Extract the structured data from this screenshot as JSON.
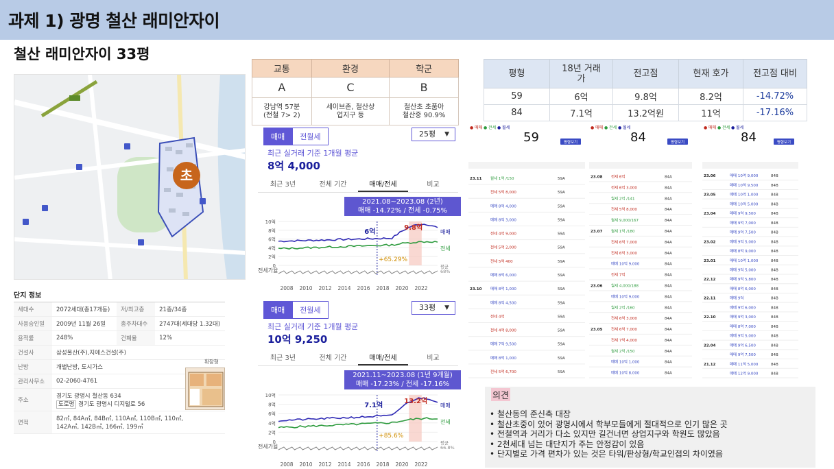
{
  "header": {
    "title": "과제 1) 광명 철산 래미안자이"
  },
  "subtitle": "철산 래미안자이 33평",
  "map": {
    "school_badge": "초"
  },
  "complex_info": {
    "title": "단지 정보",
    "rows": [
      {
        "k1": "세대수",
        "v1": "2072세대(총17개동)",
        "k2": "저/최고층",
        "v2": "21층/34층"
      },
      {
        "k1": "사용승인일",
        "v1": "2009년 11월 26일",
        "k2": "총주차대수",
        "v2": "2747대(세대당 1.32대)"
      },
      {
        "k1": "용적률",
        "v1": "248%",
        "k2": "건폐율",
        "v2": "12%"
      },
      {
        "k1": "건설사",
        "v1": "삼성물산(주),지에스건설(주)"
      },
      {
        "k1": "난방",
        "v1": "개별난방, 도시가스"
      },
      {
        "k1": "관리사무소",
        "v1": "02-2060-4761"
      },
      {
        "k1": "주소",
        "v1": "경기도 광명시 철산동 634",
        "v1b": "도로명",
        "v1c": "경기도 광명시 디지털로 56"
      },
      {
        "k1": "면적",
        "v1": "82㎡, 84A㎡, 84B㎡, 110A㎡, 110B㎡, 110㎡, 142A㎡, 142B㎡, 166㎡, 199㎡"
      }
    ],
    "floorplan_label": "확장형"
  },
  "rating": {
    "headers": [
      "교통",
      "환경",
      "학군"
    ],
    "grades": [
      "A",
      "C",
      "B"
    ],
    "notes": [
      "강남역 57분\n(전철 7> 2)",
      "세이브존, 철산상\n업지구 등",
      "철산초 초품아\n철산중 90.9%"
    ]
  },
  "price_table": {
    "headers": [
      "평형",
      "18년 거래\n가",
      "전고점",
      "현재 호가",
      "전고점 대비"
    ],
    "rows": [
      [
        "59",
        "6억",
        "9.8억",
        "8.2억",
        "-14.72%"
      ],
      [
        "84",
        "7.1억",
        "13.2억원",
        "11억",
        "-17.16%"
      ]
    ]
  },
  "panel1": {
    "seg_on": "매매",
    "seg_off": "전월세",
    "select": "25평",
    "note": "최근 실거래 기준 1개월 평균",
    "price": "8억 4,000",
    "tabs": [
      "최근 3년",
      "전체 기간",
      "매매/전세",
      "비교"
    ],
    "box_line1": "2021.08~2023.08 (2년)",
    "box_line2": "매매 -14.72% / 전세 -0.75%",
    "label_low": "6억",
    "label_high": "9.8억",
    "pct": "+65.29%",
    "legend_sale": "매매",
    "legend_rent": "전세",
    "leg_bottom_right": "평균\n68%",
    "volume": "전세가율"
  },
  "panel2": {
    "seg_on": "매매",
    "seg_off": "전월세",
    "select": "33평",
    "note": "최근 실거래 기준 1개월 평균",
    "price": "10억 9,250",
    "tabs": [
      "최근 3년",
      "전체 기간",
      "매매/전세",
      "비교"
    ],
    "box_line1": "2021.11~2023.08 (1년 9개월)",
    "box_line2": "매매 -17.23% / 전세 -17.16%",
    "label_low": "7.1억",
    "label_high": "13.2억",
    "pct": "+85.6%",
    "legend_sale": "매매",
    "legend_rent": "전세",
    "leg_bottom_right": "평균\n66.8%",
    "volume": "전세가율"
  },
  "chart_axes": {
    "y_ticks": [
      "10억",
      "8억",
      "6억",
      "4억",
      "2억",
      "0"
    ],
    "x_ticks": [
      "2008",
      "2010",
      "2012",
      "2014",
      "2016",
      "2018",
      "2020",
      "2022"
    ]
  },
  "tx": {
    "big_59": "59",
    "big_84a": "84",
    "big_84b": "84",
    "legend": [
      "● 매매",
      "● 전세",
      "● 월세"
    ],
    "dates_59": [
      "23.11",
      "23.10"
    ],
    "dates_84a": [
      "23.08",
      "23.07",
      "23.06",
      "23.05"
    ],
    "dates_84b": [
      "23.06",
      "23.05",
      "23.04",
      "23.02",
      "23.01",
      "22.12",
      "22.11",
      "22.10",
      "22.04",
      "21.12"
    ],
    "btn": "평형보기",
    "prices_59": [
      "월세 1억 /150",
      "전세 5억 8,000",
      "매매 8억 4,000",
      "매매 8억 3,000",
      "전세 4억 9,000",
      "전세 5억 2,000",
      "전세 5억 400",
      "매매 8억 6,000",
      "매매 8억 1,000",
      "매매 8억 4,500",
      "전세 4억",
      "전세 4억 8,000",
      "매매 7억 9,500",
      "매매 8억 1,000",
      "전세 5억 6,700"
    ],
    "prices_84a": [
      "전세 6억",
      "전세 6억 3,000",
      "월세 2억 /141",
      "전세 5억 8,000",
      "월세 9,000/167",
      "월세 1억 /180",
      "전세 6억 7,000",
      "전세 6억 3,000",
      "매매 10억 9,000",
      "전세 7억",
      "월세 4,000/188",
      "매매 10억 9,000",
      "월세 2억 /160",
      "전세 6억 3,000",
      "전세 6억 7,000",
      "전세 7억 4,000",
      "월세 2억 /150",
      "매매 10억 1,000",
      "매매 10억 8,000"
    ],
    "prices_84b": [
      "매매 10억 9,000",
      "매매 10억 9,500",
      "매매 10억 1,000",
      "매매 10억 5,000",
      "매매 9억 9,500",
      "매매 9억 7,000",
      "매매 9억 7,500",
      "매매 9억 5,000",
      "매매 8억 9,000",
      "매매 10억 1,000",
      "매매 9억 5,000",
      "매매 9억 5,800",
      "매매 8억 6,000",
      "매매 9억",
      "매매 9억 6,000",
      "매매 9억 3,000",
      "매매 8억 7,000",
      "매매 9억 5,000",
      "매매 9억 6,500",
      "매매 9억 7,500",
      "매매 11억 5,000",
      "매매 12억 9,000"
    ]
  },
  "opinion": {
    "title": "의견",
    "items": [
      "철산동의 준신축 대장",
      "철산초중이 있어 광명시에서 학부모들에게 절대적으로 인기 많은 곳",
      "전철역과 거리가 다소 있지만 길건너면 상업지구와 학원도 많았음",
      "2천세대 넘는 대단지가 주는 안정감이 있음",
      "단지별로 가격 편차가 있는 것은 타워/판상형/학교인접의 차이였음"
    ]
  },
  "colors": {
    "header": "#b8cbe6",
    "accent": "#5e57d0",
    "sale": "#2f2ab5",
    "rent": "#2e9b3e",
    "school": "#c7651c"
  }
}
